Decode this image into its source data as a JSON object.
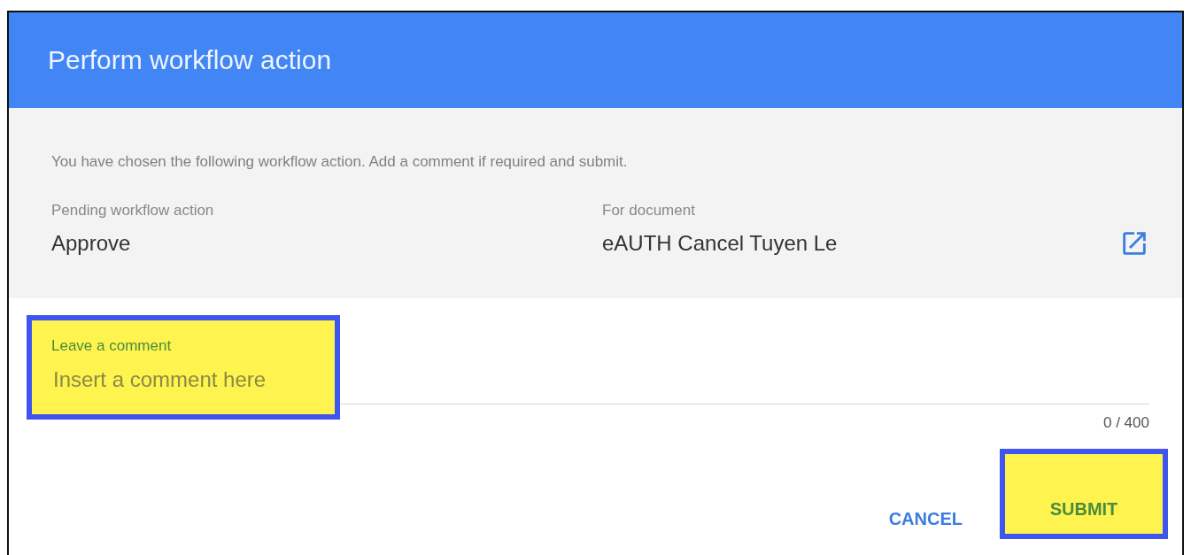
{
  "dialog": {
    "title": "Perform workflow action"
  },
  "intro": "You have chosen the following workflow action. Add a comment if required and submit.",
  "details": [
    {
      "label": "Pending workflow action",
      "value": "Approve",
      "link": false
    },
    {
      "label": "For document",
      "value": "eAUTH Cancel Tuyen Le",
      "link": true
    }
  ],
  "comment": {
    "label": "Leave a comment",
    "placeholder": "Insert a comment here",
    "counter": "0 / 400",
    "highlighted": true
  },
  "buttons": [
    {
      "label": "CANCEL",
      "highlighted": false
    },
    {
      "label": "SUBMIT",
      "highlighted": true
    }
  ]
}
